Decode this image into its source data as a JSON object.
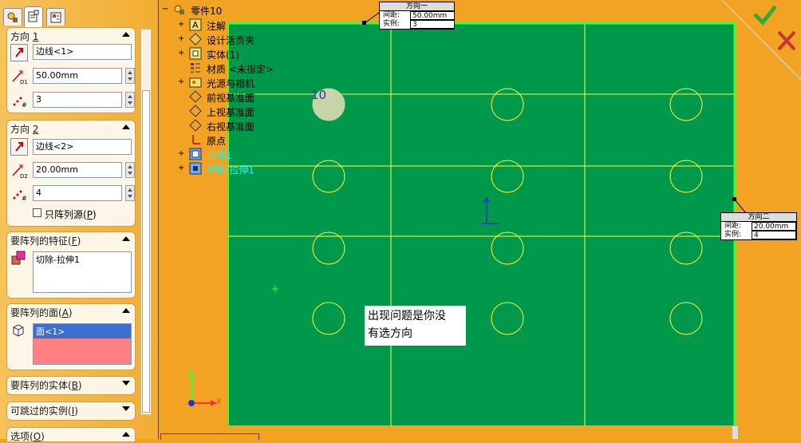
{
  "property_manager": {
    "dir1": {
      "title_prefix": "方向 ",
      "title_key": "1",
      "edge": "边线<1>",
      "spacing": "50.00mm",
      "instances": "3",
      "spacing_icon_label": "D1"
    },
    "dir2": {
      "title_prefix": "方向 ",
      "title_key": "2",
      "edge": "边线<2>",
      "spacing": "20.00mm",
      "instances": "4",
      "spacing_icon_label": "D2",
      "seed_only_prefix": "只阵列源(",
      "seed_only_key": "P",
      "seed_only_suffix": ")"
    },
    "features": {
      "title_prefix": "要阵列的特征(",
      "title_key": "F",
      "title_suffix": ")",
      "items": [
        "切除-拉伸1"
      ]
    },
    "faces": {
      "title_prefix": "要阵列的面(",
      "title_key": "A",
      "title_suffix": ")",
      "items": [
        "面<1>"
      ]
    },
    "bodies": {
      "title_prefix": "要阵列的实体(",
      "title_key": "B",
      "title_suffix": ")"
    },
    "skip": {
      "title_prefix": "可跳过的实例(",
      "title_key": "I",
      "title_suffix": ")"
    },
    "options": {
      "title_prefix": "选项(",
      "title_key": "O",
      "title_suffix": ")"
    }
  },
  "feature_tree": {
    "root": "零件10",
    "items": [
      {
        "label": "注解",
        "icon": "annotation-icon",
        "expander": "+"
      },
      {
        "label": "设计活页夹",
        "icon": "design-binder-icon",
        "expander": "+"
      },
      {
        "label": "实体(1)",
        "icon": "solid-bodies-icon",
        "expander": "+"
      },
      {
        "label": "材质 <未指定>",
        "icon": "material-icon",
        "expander": ""
      },
      {
        "label": "光源与相机",
        "icon": "lights-cameras-icon",
        "expander": "+"
      },
      {
        "label": "前视基准面",
        "icon": "plane-icon",
        "expander": ""
      },
      {
        "label": "上视基准面",
        "icon": "plane-icon",
        "expander": ""
      },
      {
        "label": "右视基准面",
        "icon": "plane-icon",
        "expander": ""
      },
      {
        "label": "原点",
        "icon": "origin-icon",
        "expander": ""
      },
      {
        "label": "拉伸1",
        "icon": "extrude-icon",
        "expander": "+",
        "highlight": true
      },
      {
        "label": "切除-拉伸1",
        "icon": "cut-extrude-icon",
        "expander": "+",
        "highlight": true
      }
    ]
  },
  "callout_dir1": {
    "title": "方向一",
    "spacing_label": "间距:",
    "spacing": "50.00mm",
    "instances_label": "实例:",
    "instances": "3"
  },
  "callout_dir2": {
    "title": "方向二",
    "spacing_label": "间距:",
    "spacing": "20.00mm",
    "instances_label": "实例:",
    "instances": "4"
  },
  "seed_label": "10",
  "note": {
    "line1": "出现问题是你没",
    "line2": "有选方向"
  },
  "axis": {
    "x": "X",
    "y": "Y"
  },
  "colors": {
    "plate": "#00994c",
    "background": "#f2a323",
    "edge_highlight": "#3cff3c",
    "pattern_lines": "#ffff33",
    "tree_highlight": "#00ffff"
  }
}
